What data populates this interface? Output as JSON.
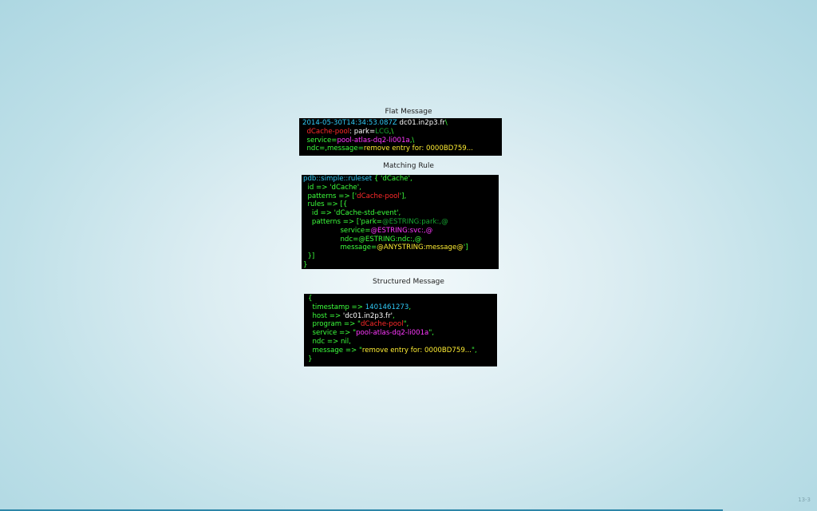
{
  "headings": {
    "flat": "Flat Message",
    "rule": "Matching Rule",
    "structured": "Structured Message"
  },
  "flat_message": {
    "timestamp": "2014-05-30T14:34:53.087Z",
    "host": "dc01.in2p3.fr",
    "cont1": "\\",
    "program_key": "dCache-pool",
    "park_label": ": park=",
    "park_value": "LCG",
    "cont2": ",\\",
    "service_label": "service=",
    "service_value": "pool-atlas-dq2-li001a",
    "cont3": ",\\",
    "ndc_label": "ndc=,message=",
    "message_value": "remove entry for: 0000BD759..."
  },
  "matching_rule": {
    "l1_a": "pdb::simple::ruleset",
    "l1_b": " { 'dCache',",
    "l2": "  id => 'dCache',",
    "l3_a": "  patterns => ['",
    "l3_b": "dCache-pool",
    "l3_c": "'],",
    "l4": "  rules => [{",
    "l5": "    id => 'dCache-std-event',",
    "l6_a": "    patterns => ['park=",
    "l6_b": "@ESTRING:park:,@",
    "l7_a": "                 service=",
    "l7_b": "@ESTRING:svc:,@",
    "l8": "                 ndc=@ESTRING:ndc:,@",
    "l9_a": "                 message=",
    "l9_b": "@ANYSTRING:message@",
    "l9_c": "']",
    "l10": "  }]",
    "l11": "}"
  },
  "structured_message": {
    "open": "{",
    "ts_label": "  timestamp => ",
    "ts_value": "1401461273",
    "ts_end": ",",
    "host_label": "  host => ",
    "host_value": "'dc01.in2p3.fr'",
    "host_end": ",",
    "program_label": "  program => \"",
    "program_value": "dCache-pool",
    "program_end": "\",",
    "service_label": "  service => \"",
    "service_value": "pool-atlas-dq2-li001a",
    "service_end": "\",",
    "ndc_line": "  ndc => nil,",
    "message_label": "  message => \"",
    "message_value": "remove entry for: 0000BD759...",
    "message_end": "\",",
    "close": "}"
  },
  "footer": {
    "slide_number": "13-3"
  },
  "colors": {
    "terminal_bg": "#000000",
    "green": "#3cff3c",
    "cyan": "#30c9f5",
    "red": "#ff2a2a",
    "magenta": "#ff38ff",
    "yellow": "#ffee33",
    "progress_bar": "#2c86a8"
  }
}
